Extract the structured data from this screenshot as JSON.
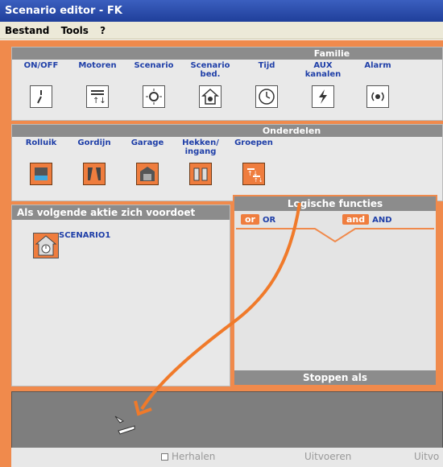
{
  "window": {
    "title": "Scenario editor - FK"
  },
  "menu": [
    "Bestand",
    "Tools",
    "?"
  ],
  "familie": {
    "title": "Familie",
    "items": [
      {
        "label": "ON/OFF",
        "icon": "switch-icon"
      },
      {
        "label": "Motoren",
        "icon": "motor-icon"
      },
      {
        "label": "Scenario",
        "icon": "scenario-sun-icon"
      },
      {
        "label": "Scenario bed.",
        "icon": "scenario-house-icon"
      },
      {
        "label": "Tijd",
        "icon": "clock-icon"
      },
      {
        "label": "AUX kanalen",
        "icon": "lightning-icon"
      },
      {
        "label": "Alarm",
        "icon": "alarm-icon"
      }
    ]
  },
  "onderdelen": {
    "title": "Onderdelen",
    "items": [
      {
        "label": "Rolluik",
        "icon": "shutter-icon"
      },
      {
        "label": "Gordijn",
        "icon": "curtain-icon"
      },
      {
        "label": "Garage",
        "icon": "garage-icon"
      },
      {
        "label": "Hekken/ ingang",
        "icon": "gate-icon"
      },
      {
        "label": "Groepen",
        "icon": "groups-icon"
      }
    ]
  },
  "trigger_panel": {
    "title": "Als volgende aktie zich voordoet",
    "item": {
      "label": "SCENARIO1",
      "icon": "scenario-clock-icon"
    }
  },
  "logic_panel": {
    "title": "Logische functies",
    "or": {
      "tag": "or",
      "label": "OR"
    },
    "and": {
      "tag": "and",
      "label": "AND"
    },
    "stop_title": "Stoppen als"
  },
  "footer": {
    "repeat": "Herhalen",
    "execute": "Uitvoeren",
    "execute2": "Uitvo"
  },
  "colors": {
    "accent": "#f08a4c",
    "panel": "#e9e9e9",
    "header": "#8c8c8c",
    "label": "#1f3fa8"
  }
}
